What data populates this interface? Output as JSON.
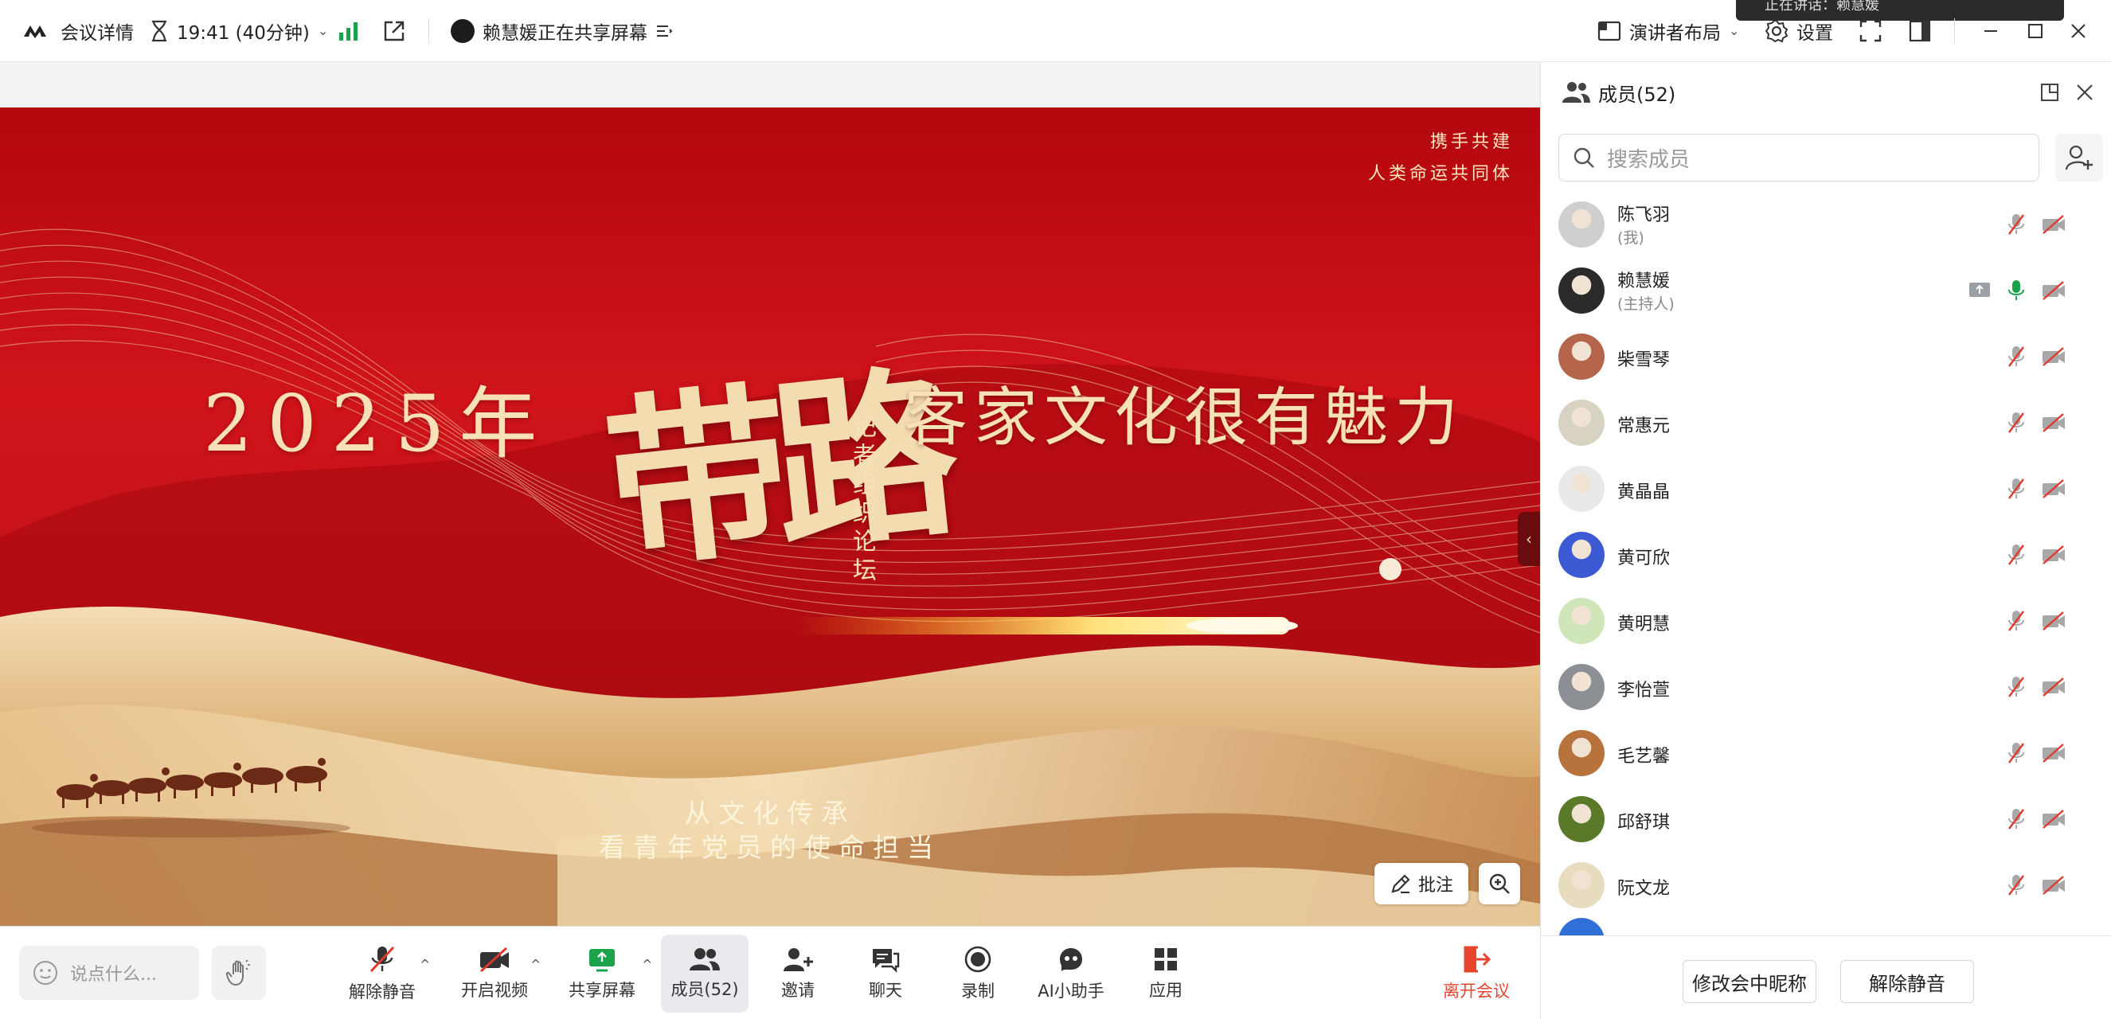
{
  "topbar": {
    "meeting_details": "会议详情",
    "time": "19:41 (40分钟)",
    "sharing_status": "赖慧媛正在共享屏幕",
    "layout_label": "演讲者布局",
    "settings_label": "设置",
    "notification_text": "正在讲话：赖慧媛"
  },
  "slide": {
    "top_right_line1": "携手共建",
    "top_right_line2": "人类命运共同体",
    "year": "2025年",
    "calligraphy": "带路",
    "vertical": "记者组织论坛",
    "headline": "客家文化很有魅力",
    "bottom_line1": "从文化传承",
    "bottom_line2": "看青年党员的使命担当",
    "annotate_label": "批注"
  },
  "toolbar": {
    "chat_placeholder": "说点什么...",
    "unmute": "解除静音",
    "start_video": "开启视频",
    "share_screen": "共享屏幕",
    "members": "成员(52)",
    "invite": "邀请",
    "chat": "聊天",
    "record": "录制",
    "ai_assistant": "AI小助手",
    "apps": "应用",
    "leave": "离开会议",
    "leave_color": "#e8452e",
    "share_color": "#1aa34a"
  },
  "panel": {
    "title": "成员(52)",
    "search_placeholder": "搜索成员",
    "members": [
      {
        "name": "陈飞羽",
        "sub": "(我)",
        "mic": "muted",
        "cam": "off",
        "avatar": "#cfcfcf"
      },
      {
        "name": "赖慧媛",
        "sub": "(主持人)",
        "mic": "active",
        "cam": "off",
        "sharing": true,
        "avatar": "#2a2a2a"
      },
      {
        "name": "柴雪琴",
        "sub": "",
        "mic": "muted",
        "cam": "off",
        "avatar": "#b5654a"
      },
      {
        "name": "常惠元",
        "sub": "",
        "mic": "muted",
        "cam": "off",
        "avatar": "#d8d2c2"
      },
      {
        "name": "黄晶晶",
        "sub": "",
        "mic": "muted",
        "cam": "off",
        "avatar": "#e9e9e9"
      },
      {
        "name": "黄可欣",
        "sub": "",
        "mic": "muted",
        "cam": "off",
        "avatar": "#3c5ad4"
      },
      {
        "name": "黄明慧",
        "sub": "",
        "mic": "muted",
        "cam": "off",
        "avatar": "#cfe6b8"
      },
      {
        "name": "李怡萱",
        "sub": "",
        "mic": "muted",
        "cam": "off",
        "avatar": "#8c8f94"
      },
      {
        "name": "毛艺馨",
        "sub": "",
        "mic": "muted",
        "cam": "off",
        "avatar": "#b8723c"
      },
      {
        "name": "邱舒琪",
        "sub": "",
        "mic": "muted",
        "cam": "off",
        "avatar": "#5a7a2a"
      },
      {
        "name": "阮文龙",
        "sub": "",
        "mic": "muted",
        "cam": "off",
        "avatar": "#e8dcc0"
      }
    ],
    "rename_button": "修改会中昵称",
    "unmute_button": "解除静音"
  }
}
